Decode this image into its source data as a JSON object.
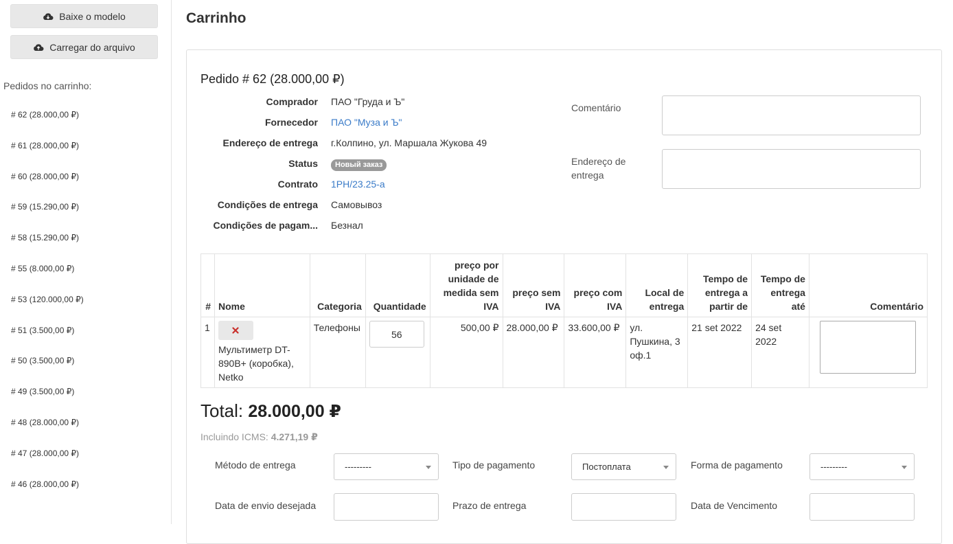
{
  "sidebar": {
    "download_label": "Baixe o modelo",
    "upload_label": "Carregar do arquivo",
    "orders_title": "Pedidos no carrinho:",
    "orders": [
      "# 62 (28.000,00 ₽)",
      "# 61 (28.000,00 ₽)",
      "# 60 (28.000,00 ₽)",
      "# 59 (15.290,00 ₽)",
      "# 58 (15.290,00 ₽)",
      "# 55 (8.000,00 ₽)",
      "# 53 (120.000,00 ₽)",
      "# 51 (3.500,00 ₽)",
      "# 50 (3.500,00 ₽)",
      "# 49 (3.500,00 ₽)",
      "# 48 (28.000,00 ₽)",
      "# 47 (28.000,00 ₽)",
      "# 46 (28.000,00 ₽)"
    ]
  },
  "page": {
    "title": "Carrinho"
  },
  "order": {
    "heading": "Pedido # 62 (28.000,00 ₽)",
    "info": [
      {
        "label": "Comprador",
        "value": "ПАО \"Груда и Ъ\""
      },
      {
        "label": "Fornecedor",
        "value": "ПАО \"Муза и Ъ\""
      },
      {
        "label": "Endereço de entrega",
        "value": "г.Колпино, ул. Маршала Жукова 49"
      },
      {
        "label": "Status",
        "value": "Новый заказ"
      },
      {
        "label": "Contrato",
        "value": "1PH/23.25-a"
      },
      {
        "label": "Condições de entrega",
        "value": "Самовывоз"
      },
      {
        "label": "Condições de pagam...",
        "value": "Безнал"
      }
    ],
    "comment_label": "Comentário",
    "address_label": "Endereço de entrega"
  },
  "table": {
    "headers": {
      "num": "#",
      "name": "Nome",
      "category": "Categoria",
      "quantity": "Quantidade",
      "unit_price": "preço por unidade de medida sem IVA",
      "price_no_vat": "preço sem IVA",
      "price_vat": "preço com IVA",
      "location": "Local de entrega",
      "time_from": "Tempo de entrega a partir de",
      "time_to": "Tempo de entrega até",
      "comment": "Comentário"
    },
    "rows": [
      {
        "num": "1",
        "name": "Мультиметр DT-890B+ (коробка), Netko",
        "category": "Телефоны",
        "quantity": "56",
        "unit_price": "500,00 ₽",
        "price_no_vat": "28.000,00 ₽",
        "price_vat": "33.600,00 ₽",
        "location": "ул. Пушкина, 3 оф.1",
        "time_from": "21 set 2022",
        "time_to": "24 set 2022"
      }
    ]
  },
  "totals": {
    "total_label": "Total:",
    "total_value": "28.000,00 ₽",
    "icms_label": "Incluindo ICMS:",
    "icms_value": "4.271,19 ₽"
  },
  "form": {
    "delivery_method_label": "Método de entrega",
    "delivery_method_value": "---------",
    "payment_type_label": "Tipo de pagamento",
    "payment_type_value": "Постоплата",
    "payment_form_label": "Forma de pagamento",
    "payment_form_value": "---------",
    "desired_ship_date_label": "Data de envio desejada",
    "delivery_term_label": "Prazo de entrega",
    "due_date_label": "Data de Vencimento"
  },
  "colors": {
    "link": "#3a7bc8",
    "badge": "#999999",
    "delete_icon": "#c9302c"
  }
}
